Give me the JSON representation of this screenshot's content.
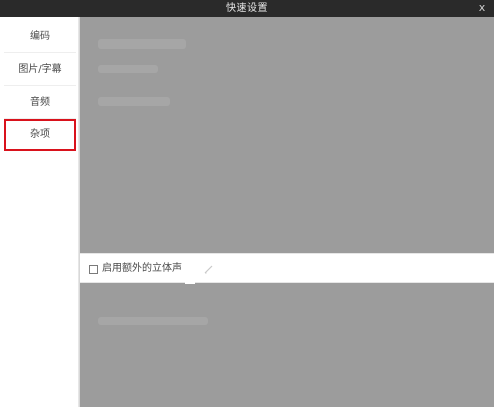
{
  "window": {
    "title": "快速设置",
    "close_label": "x"
  },
  "sidebar": {
    "items": [
      {
        "label": "编码"
      },
      {
        "label": "图片/字幕"
      },
      {
        "label": "音频"
      },
      {
        "label": "杂项"
      }
    ],
    "selected_index": 3,
    "highlight_color": "#d9121c"
  },
  "options": {
    "stereo_checkbox_label": "启用额外的立体声",
    "stereo_checked": false
  },
  "colors": {
    "titlebar": "#2a2a2a",
    "overlay": "#9c9c9c"
  }
}
